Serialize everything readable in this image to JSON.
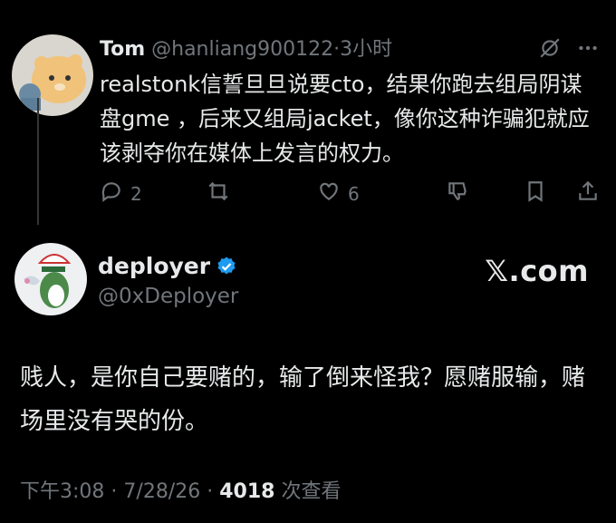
{
  "reply": {
    "name": "Tom",
    "handle": "@hanliang900122",
    "separator": "·",
    "time": "3小时",
    "text": "realstonk信誓旦旦说要cto，结果你跑去组局阴谋盘gme ，后来又组局jacket，像你这种诈骗犯就应该剥夺你在媒体上发言的权力。",
    "actions": {
      "replies": "2",
      "reposts": "",
      "likes": "6"
    },
    "icons": [
      "grok-icon",
      "more-icon",
      "reply-icon",
      "repost-icon",
      "like-icon",
      "dislike-icon",
      "bookmark-icon",
      "share-icon"
    ]
  },
  "main": {
    "name": "deployer",
    "handle": "@0xDeployer",
    "watermark": "𝕏.com",
    "text": "贱人，是你自己要赌的，输了倒来怪我？愿赌服输，赌场里没有哭的份。",
    "time": "下午3:08",
    "sep1": "·",
    "date": "7/28/26",
    "sep2": "·",
    "views": "4018",
    "views_label": "次查看",
    "verified_color": "#1d9bf0"
  },
  "colors": {
    "background": "#000000",
    "text": "#e7e9ea",
    "muted": "#71767b"
  }
}
